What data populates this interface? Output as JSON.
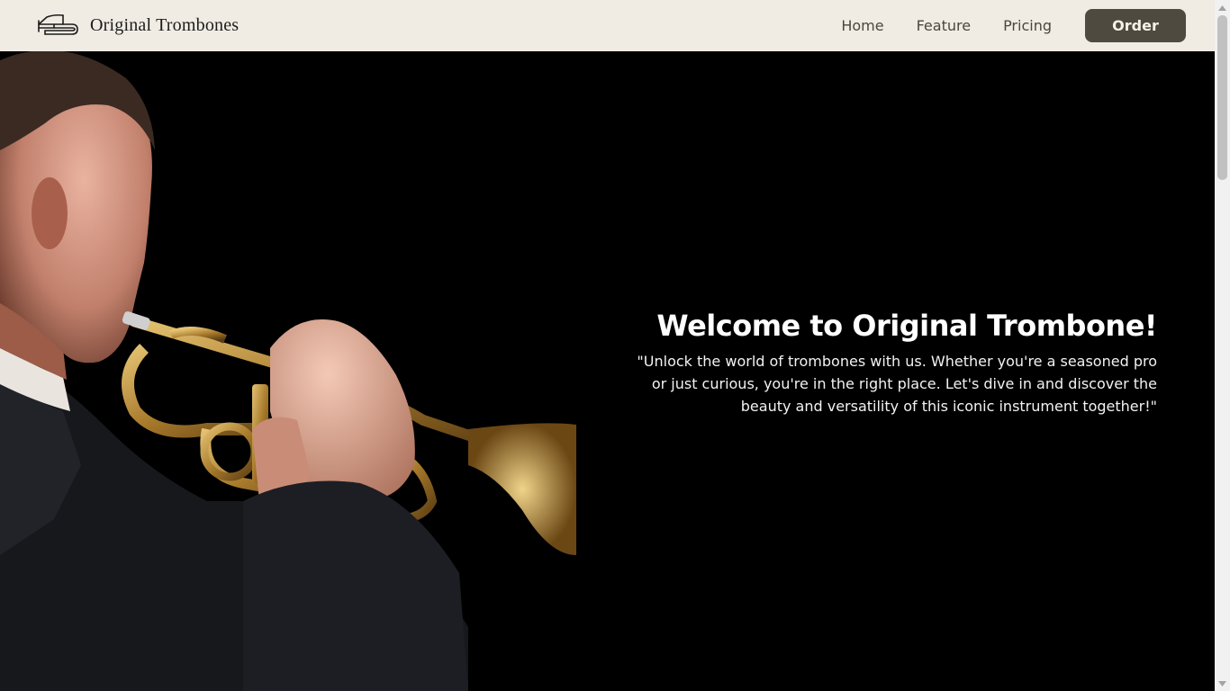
{
  "header": {
    "brand": "Original Trombones",
    "logo_icon": "trombone-icon",
    "nav": [
      "Home",
      "Feature",
      "Pricing"
    ],
    "order_label": "Order"
  },
  "hero": {
    "image": "trumpet-player-photo",
    "title": "Welcome to Original Trombone!",
    "subtitle": "\"Unlock the world of trombones with us. Whether you're a seasoned pro or just curious, you're in the right place. Let's dive in and discover the beauty and versatility of this iconic instrument together!\""
  },
  "colors": {
    "header_bg": "#f0ece4",
    "button_bg": "#4e4a40",
    "nav_text": "#4b463d",
    "hero_bg": "#000000"
  }
}
